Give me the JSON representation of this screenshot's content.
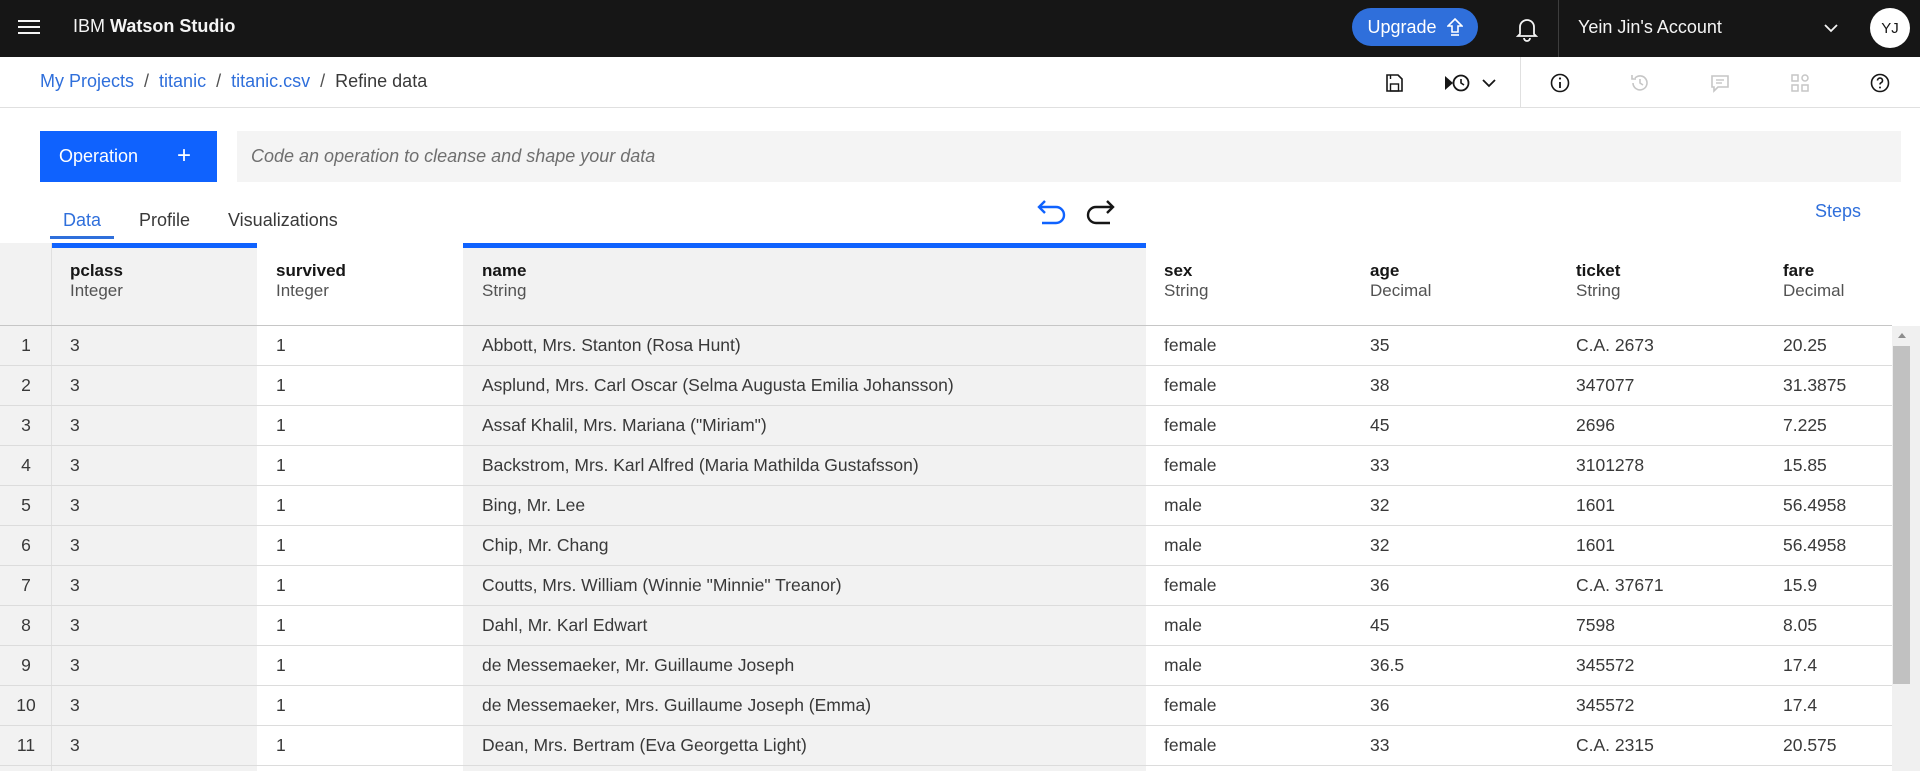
{
  "topbar": {
    "brand_prefix": "IBM",
    "brand_name": "Watson Studio",
    "upgrade_label": "Upgrade",
    "account_label": "Yein Jin's Account",
    "avatar_initials": "YJ"
  },
  "breadcrumb": {
    "items": [
      "My Projects",
      "titanic",
      "titanic.csv"
    ],
    "current": "Refine data",
    "separator": "/"
  },
  "operation": {
    "button_label": "Operation",
    "button_plus": "+",
    "input_placeholder": "Code an operation to cleanse and shape your data"
  },
  "tabs": [
    {
      "label": "Data",
      "active": true
    },
    {
      "label": "Profile",
      "active": false
    },
    {
      "label": "Visualizations",
      "active": false
    }
  ],
  "steps_label": "Steps",
  "columns": [
    {
      "name": "pclass",
      "type": "Integer"
    },
    {
      "name": "survived",
      "type": "Integer"
    },
    {
      "name": "name",
      "type": "String"
    },
    {
      "name": "sex",
      "type": "String"
    },
    {
      "name": "age",
      "type": "Decimal"
    },
    {
      "name": "ticket",
      "type": "String"
    },
    {
      "name": "fare",
      "type": "Decimal"
    }
  ],
  "rows": [
    {
      "n": "1",
      "cells": [
        "3",
        "1",
        "Abbott, Mrs. Stanton (Rosa Hunt)",
        "female",
        "35",
        "C.A. 2673",
        "20.25"
      ]
    },
    {
      "n": "2",
      "cells": [
        "3",
        "1",
        "Asplund, Mrs. Carl Oscar (Selma Augusta Emilia Johansson)",
        "female",
        "38",
        "347077",
        "31.3875"
      ]
    },
    {
      "n": "3",
      "cells": [
        "3",
        "1",
        "Assaf Khalil, Mrs. Mariana (\"Miriam\")",
        "female",
        "45",
        "2696",
        "7.225"
      ]
    },
    {
      "n": "4",
      "cells": [
        "3",
        "1",
        "Backstrom, Mrs. Karl Alfred (Maria Mathilda Gustafsson)",
        "female",
        "33",
        "3101278",
        "15.85"
      ]
    },
    {
      "n": "5",
      "cells": [
        "3",
        "1",
        "Bing, Mr. Lee",
        "male",
        "32",
        "1601",
        "56.4958"
      ]
    },
    {
      "n": "6",
      "cells": [
        "3",
        "1",
        "Chip, Mr. Chang",
        "male",
        "32",
        "1601",
        "56.4958"
      ]
    },
    {
      "n": "7",
      "cells": [
        "3",
        "1",
        "Coutts, Mrs. William (Winnie \"Minnie\" Treanor)",
        "female",
        "36",
        "C.A. 37671",
        "15.9"
      ]
    },
    {
      "n": "8",
      "cells": [
        "3",
        "1",
        "Dahl, Mr. Karl Edwart",
        "male",
        "45",
        "7598",
        "8.05"
      ]
    },
    {
      "n": "9",
      "cells": [
        "3",
        "1",
        "de Messemaeker, Mr. Guillaume Joseph",
        "male",
        "36.5",
        "345572",
        "17.4"
      ]
    },
    {
      "n": "10",
      "cells": [
        "3",
        "1",
        "de Messemaeker, Mrs. Guillaume Joseph (Emma)",
        "female",
        "36",
        "345572",
        "17.4"
      ]
    },
    {
      "n": "11",
      "cells": [
        "3",
        "1",
        "Dean, Mrs. Bertram (Eva Georgetta Light)",
        "female",
        "33",
        "C.A. 2315",
        "20.575"
      ]
    }
  ],
  "colors": {
    "topbar_bg": "#161616",
    "accent": "#0f62fe",
    "link": "#2f6fdb",
    "upgrade_bg": "#2f6fdb"
  },
  "icons": {
    "menu": "hamburger-icon",
    "upgrade": "arrow-up-icon",
    "notifications": "bell-icon",
    "account_menu": "chevron-down-icon",
    "save": "save-icon",
    "run_history": "run-history-icon",
    "info": "info-icon",
    "history": "history-icon",
    "comments": "comment-icon",
    "assets": "grid-icon",
    "help": "help-icon",
    "undo": "undo-icon",
    "redo": "redo-icon"
  }
}
